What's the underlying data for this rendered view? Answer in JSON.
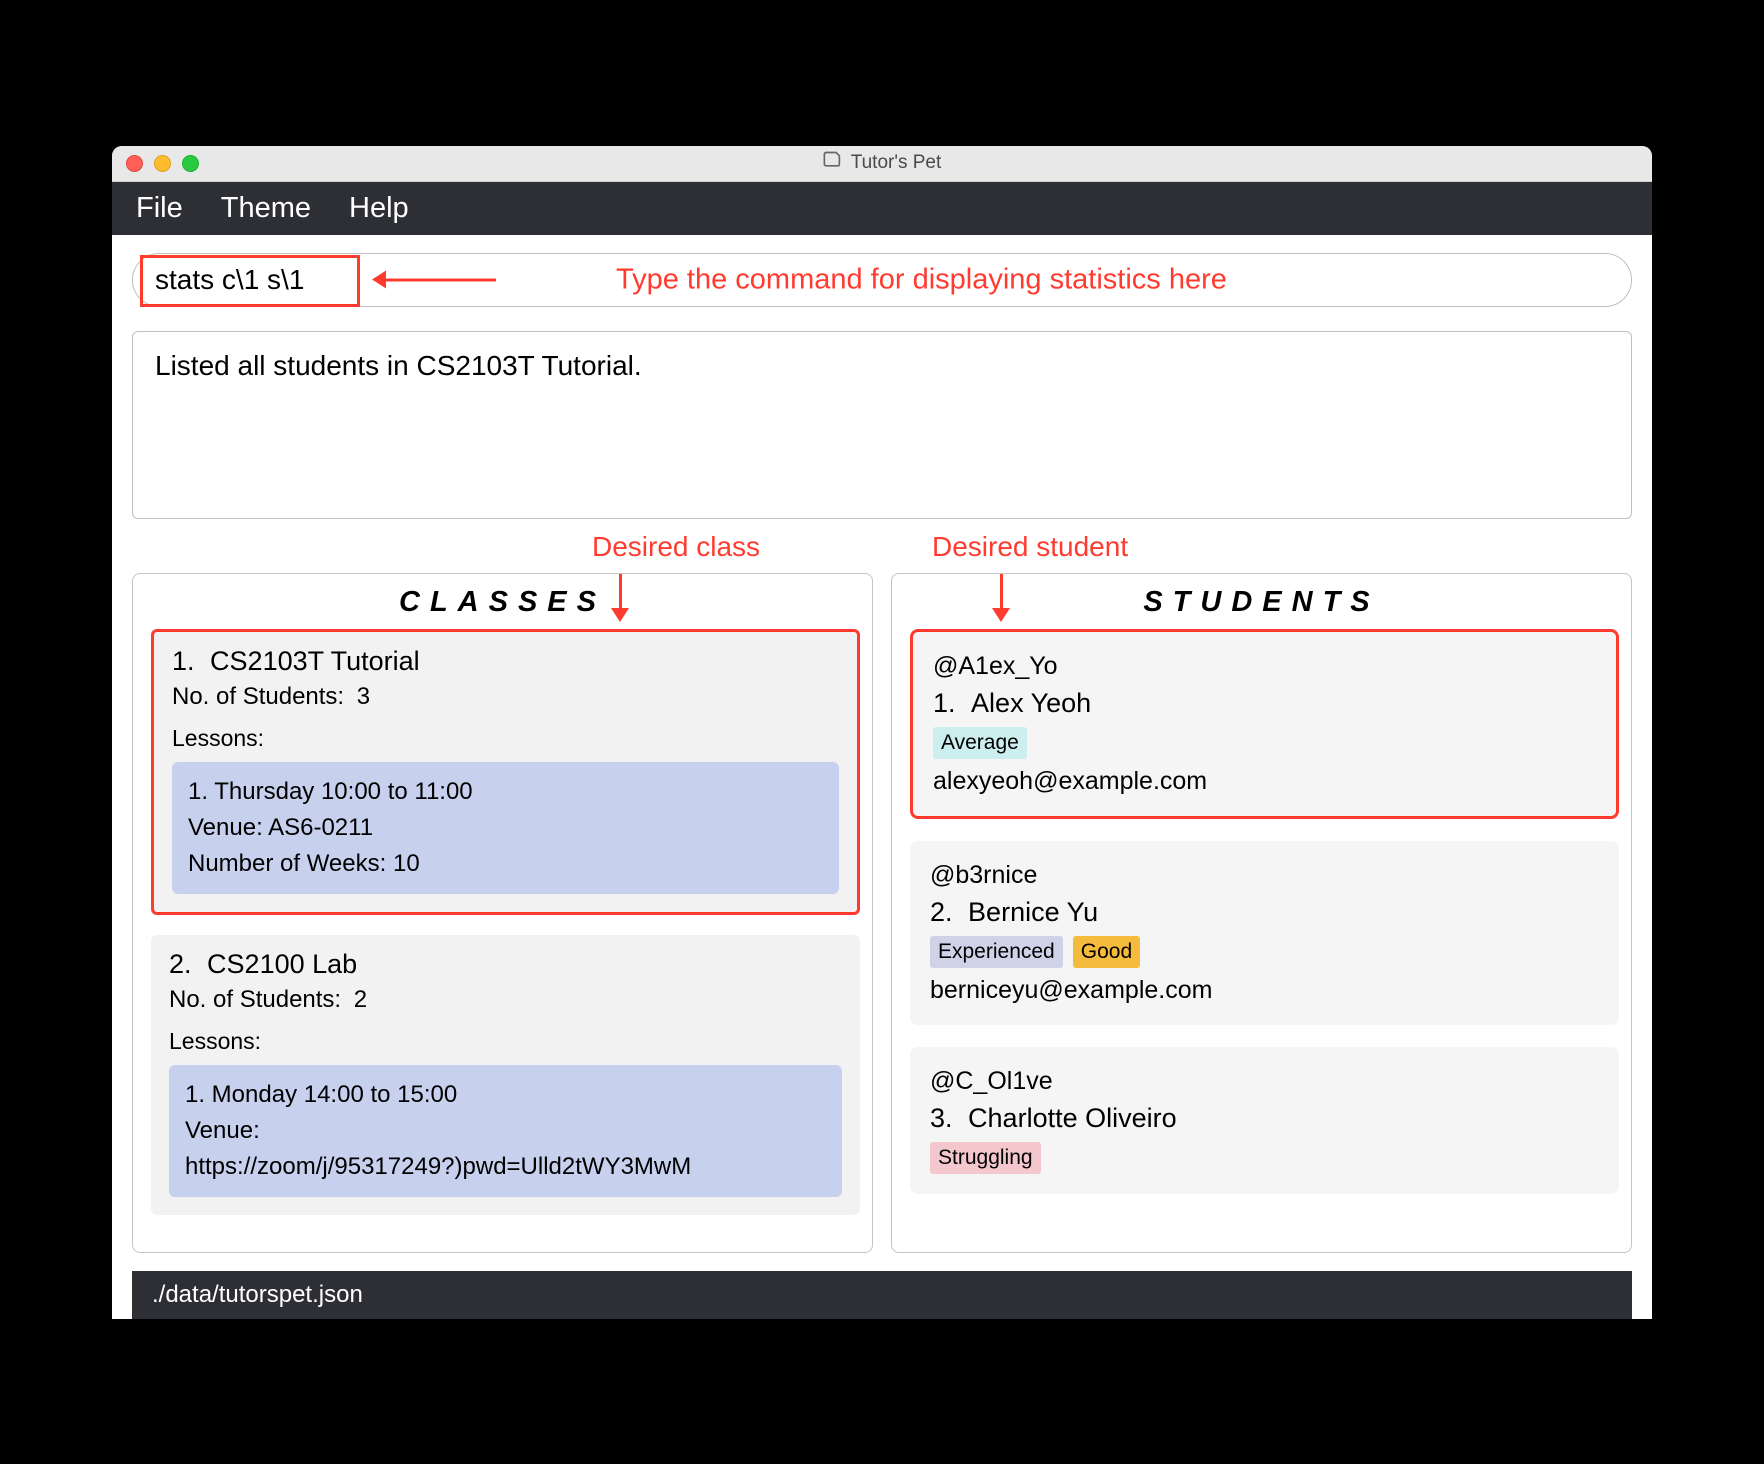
{
  "window": {
    "title": "Tutor's Pet"
  },
  "menu": {
    "file": "File",
    "theme": "Theme",
    "help": "Help"
  },
  "command": {
    "value": "stats c\\1 s\\1",
    "annotation": "Type the command for displaying statistics here"
  },
  "result": "Listed all students in CS2103T Tutorial.",
  "annotations": {
    "desired_class": "Desired class",
    "desired_student": "Desired student"
  },
  "classes": {
    "heading": "CLASSES",
    "items": [
      {
        "index": "1.",
        "name": "CS2103T Tutorial",
        "students_label": "No. of Students:",
        "students_count": "3",
        "lessons_label": "Lessons:",
        "lessons": [
          {
            "line1": "1. Thursday 10:00 to 11:00",
            "venue_label": "Venue:",
            "venue": "AS6-0211",
            "weeks_label": "Number of Weeks:",
            "weeks": "10"
          }
        ]
      },
      {
        "index": "2.",
        "name": "CS2100 Lab",
        "students_label": "No. of Students:",
        "students_count": "2",
        "lessons_label": "Lessons:",
        "lessons": [
          {
            "line1": "1. Monday 14:00 to 15:00",
            "venue_label": "Venue:",
            "venue": "https://zoom/j/95317249?)pwd=Ulld2tWY3MwM",
            "weeks_label": "",
            "weeks": ""
          }
        ]
      }
    ]
  },
  "students": {
    "heading": "STUDENTS",
    "items": [
      {
        "handle": "@A1ex_Yo",
        "index": "1.",
        "name": "Alex Yeoh",
        "tags": [
          {
            "text": "Average",
            "cls": "avg"
          }
        ],
        "email": "alexyeoh@example.com"
      },
      {
        "handle": "@b3rnice",
        "index": "2.",
        "name": "Bernice Yu",
        "tags": [
          {
            "text": "Experienced",
            "cls": "exp"
          },
          {
            "text": "Good",
            "cls": "good"
          }
        ],
        "email": "berniceyu@example.com"
      },
      {
        "handle": "@C_Ol1ve",
        "index": "3.",
        "name": "Charlotte Oliveiro",
        "tags": [
          {
            "text": "Struggling",
            "cls": "strug"
          }
        ],
        "email": ""
      }
    ]
  },
  "statusbar": "./data/tutorspet.json"
}
